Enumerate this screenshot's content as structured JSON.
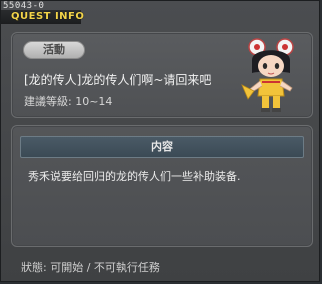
{
  "window": {
    "quest_id": "55043-0",
    "title": "QUEST INFO"
  },
  "quest": {
    "category": "活動",
    "title": "[龙的传人]龙的传人们啊~请回来吧",
    "level": "建議等級: 10~14"
  },
  "content": {
    "header": "内容",
    "description": "秀禾说要给回归的龙的传人们一些补助装备."
  },
  "status": {
    "text": "狀態: 可開始 / 不可執行任務"
  },
  "colors": {
    "title": "#f2d44a",
    "panel": "#555759",
    "section_header": "#3f4e59"
  },
  "icons": {
    "npc": "npc-portrait-icon"
  }
}
